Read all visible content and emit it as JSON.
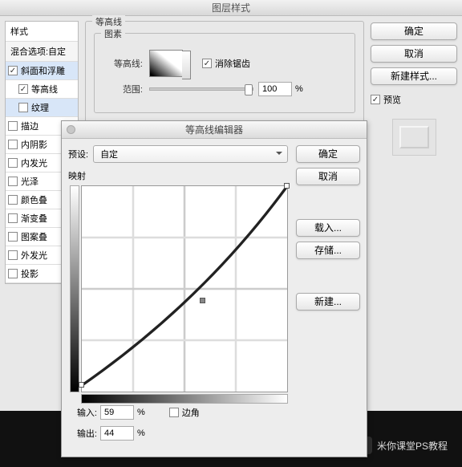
{
  "window": {
    "title": "图层样式"
  },
  "styles": {
    "header": "样式",
    "blend": "混合选项:自定",
    "items": [
      {
        "label": "斜面和浮雕",
        "checked": true,
        "selected": true
      },
      {
        "label": "等高线",
        "checked": true,
        "sub": true
      },
      {
        "label": "纹理",
        "checked": false,
        "sub": true,
        "selected": true
      },
      {
        "label": "描边",
        "checked": false
      },
      {
        "label": "内阴影",
        "checked": false
      },
      {
        "label": "内发光",
        "checked": false
      },
      {
        "label": "光泽",
        "checked": false
      },
      {
        "label": "颜色叠",
        "checked": false
      },
      {
        "label": "渐变叠",
        "checked": false
      },
      {
        "label": "图案叠",
        "checked": false
      },
      {
        "label": "外发光",
        "checked": false
      },
      {
        "label": "投影",
        "checked": false
      }
    ]
  },
  "contour_panel": {
    "group_title": "等高线",
    "elements_title": "图素",
    "contour_label": "等高线:",
    "anti_alias": "消除锯齿",
    "range_label": "范围:",
    "range_value": "100",
    "percent": "%"
  },
  "right": {
    "ok": "确定",
    "cancel": "取消",
    "new_style": "新建样式...",
    "preview": "预览"
  },
  "editor": {
    "title": "等高线编辑器",
    "preset_label": "预设:",
    "preset_value": "自定",
    "mapping_label": "映射",
    "ok": "确定",
    "cancel": "取消",
    "load": "载入...",
    "save": "存储...",
    "new": "新建...",
    "input_label": "输入:",
    "input_value": "59",
    "output_label": "输出:",
    "output_value": "44",
    "corner_label": "边角",
    "percent": "%"
  },
  "chart_data": {
    "type": "line",
    "title": "映射",
    "xlabel": "输入",
    "ylabel": "输出",
    "xlim": [
      0,
      100
    ],
    "ylim": [
      0,
      100
    ],
    "series": [
      {
        "name": "contour",
        "points": [
          {
            "x": 0,
            "y": 3
          },
          {
            "x": 59,
            "y": 44
          },
          {
            "x": 100,
            "y": 100
          }
        ]
      }
    ]
  },
  "watermark": {
    "text": "米你课堂PS教程"
  }
}
